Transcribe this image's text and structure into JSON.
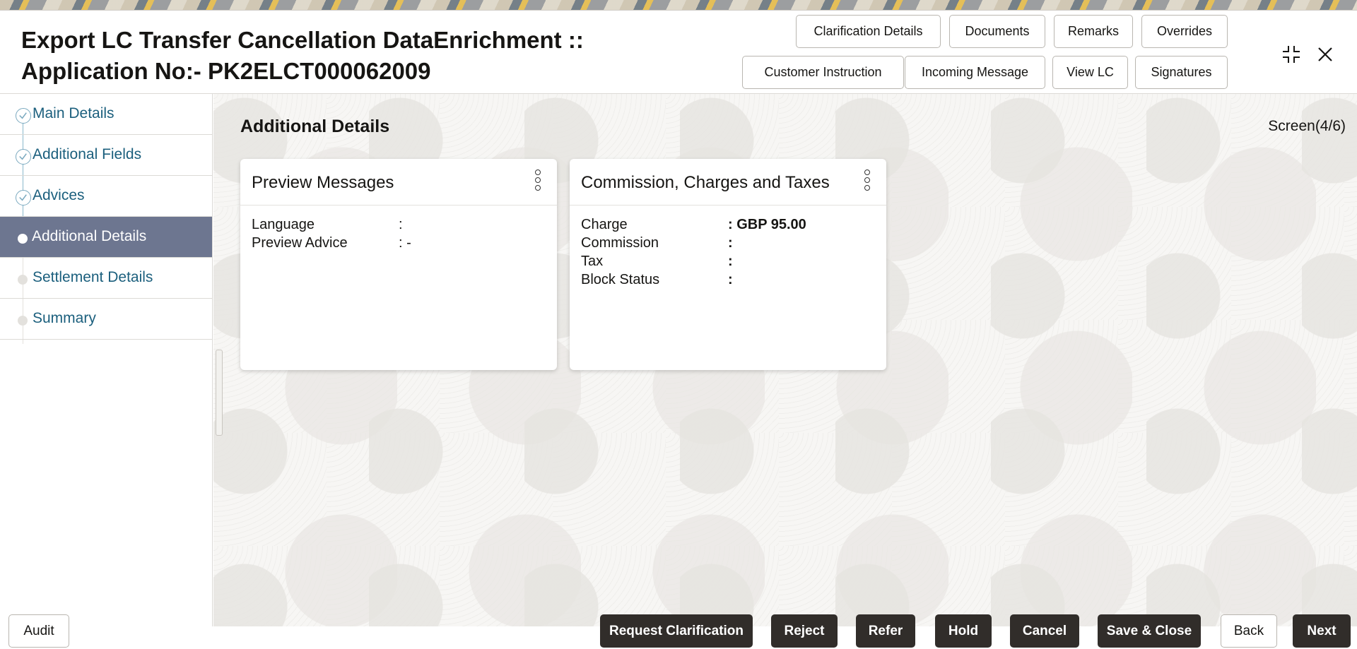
{
  "header": {
    "title_line1": "Export LC Transfer Cancellation DataEnrichment ::",
    "title_line2": "Application No:- PK2ELCT000062009",
    "buttons_row1": [
      "Clarification Details",
      "Documents",
      "Remarks",
      "Overrides"
    ],
    "buttons_row2": [
      "Customer Instruction",
      "Incoming Message",
      "View LC",
      "Signatures"
    ],
    "icons": [
      "minimize-icon",
      "close-icon"
    ]
  },
  "sidebar": {
    "items": [
      {
        "label": "Main Details",
        "state": "completed"
      },
      {
        "label": "Additional Fields",
        "state": "completed"
      },
      {
        "label": "Advices",
        "state": "completed"
      },
      {
        "label": "Additional Details",
        "state": "active"
      },
      {
        "label": "Settlement Details",
        "state": "pending"
      },
      {
        "label": "Summary",
        "state": "pending"
      }
    ]
  },
  "main": {
    "section_title": "Additional Details",
    "screen_count": "Screen(4/6)",
    "cards": [
      {
        "title": "Preview Messages",
        "rows": [
          {
            "key": "Language",
            "value": ":"
          },
          {
            "key": "Preview Advice",
            "value": ": -"
          }
        ]
      },
      {
        "title": "Commission, Charges and Taxes",
        "rows": [
          {
            "key": "Charge",
            "value": ": GBP  95.00"
          },
          {
            "key": "Commission",
            "value": ":"
          },
          {
            "key": "Tax",
            "value": ":"
          },
          {
            "key": "Block Status",
            "value": ":"
          }
        ]
      }
    ]
  },
  "footer": {
    "audit": "Audit",
    "request_clarification": "Request Clarification",
    "reject": "Reject",
    "refer": "Refer",
    "hold": "Hold",
    "cancel": "Cancel",
    "save_close": "Save & Close",
    "back": "Back",
    "next": "Next"
  },
  "colors": {
    "active_nav_bg": "#6d7690",
    "nav_link": "#1b5f7d",
    "dark_button": "#312d2a"
  }
}
